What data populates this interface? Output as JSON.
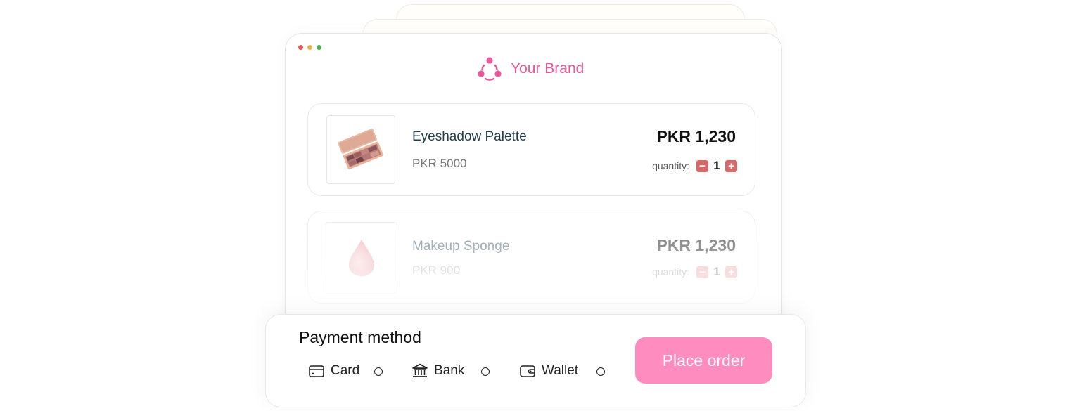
{
  "brand": {
    "name": "Your Brand",
    "logo_icon": "brand-logo-icon",
    "color": "#e8589a"
  },
  "cart": {
    "quantity_label": "quantity:",
    "items": [
      {
        "name": "Eyeshadow Palette",
        "unit_price": "PKR 5000",
        "total": "PKR 1,230",
        "quantity": "1",
        "image_icon": "eyeshadow-palette-image"
      },
      {
        "name": "Makeup Sponge",
        "unit_price": "PKR 900",
        "total": "PKR 1,230",
        "quantity": "1",
        "image_icon": "makeup-sponge-image"
      }
    ],
    "decrement_symbol": "−",
    "increment_symbol": "+"
  },
  "payment": {
    "title": "Payment method",
    "options": [
      {
        "label": "Card",
        "icon": "credit-card-icon"
      },
      {
        "label": "Bank",
        "icon": "bank-icon"
      },
      {
        "label": "Wallet",
        "icon": "wallet-icon"
      }
    ],
    "place_order_label": "Place order",
    "button_color": "#ff8cbe"
  }
}
